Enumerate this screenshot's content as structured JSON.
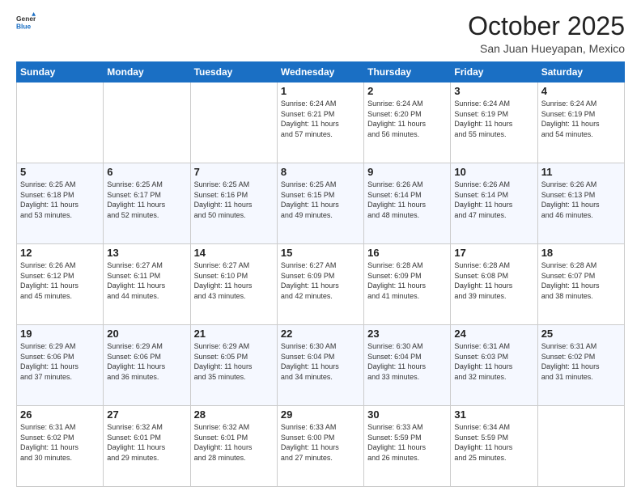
{
  "logo": {
    "general": "General",
    "blue": "Blue"
  },
  "title": "October 2025",
  "location": "San Juan Hueyapan, Mexico",
  "weekdays": [
    "Sunday",
    "Monday",
    "Tuesday",
    "Wednesday",
    "Thursday",
    "Friday",
    "Saturday"
  ],
  "weeks": [
    [
      {
        "day": "",
        "info": ""
      },
      {
        "day": "",
        "info": ""
      },
      {
        "day": "",
        "info": ""
      },
      {
        "day": "1",
        "info": "Sunrise: 6:24 AM\nSunset: 6:21 PM\nDaylight: 11 hours\nand 57 minutes."
      },
      {
        "day": "2",
        "info": "Sunrise: 6:24 AM\nSunset: 6:20 PM\nDaylight: 11 hours\nand 56 minutes."
      },
      {
        "day": "3",
        "info": "Sunrise: 6:24 AM\nSunset: 6:19 PM\nDaylight: 11 hours\nand 55 minutes."
      },
      {
        "day": "4",
        "info": "Sunrise: 6:24 AM\nSunset: 6:19 PM\nDaylight: 11 hours\nand 54 minutes."
      }
    ],
    [
      {
        "day": "5",
        "info": "Sunrise: 6:25 AM\nSunset: 6:18 PM\nDaylight: 11 hours\nand 53 minutes."
      },
      {
        "day": "6",
        "info": "Sunrise: 6:25 AM\nSunset: 6:17 PM\nDaylight: 11 hours\nand 52 minutes."
      },
      {
        "day": "7",
        "info": "Sunrise: 6:25 AM\nSunset: 6:16 PM\nDaylight: 11 hours\nand 50 minutes."
      },
      {
        "day": "8",
        "info": "Sunrise: 6:25 AM\nSunset: 6:15 PM\nDaylight: 11 hours\nand 49 minutes."
      },
      {
        "day": "9",
        "info": "Sunrise: 6:26 AM\nSunset: 6:14 PM\nDaylight: 11 hours\nand 48 minutes."
      },
      {
        "day": "10",
        "info": "Sunrise: 6:26 AM\nSunset: 6:14 PM\nDaylight: 11 hours\nand 47 minutes."
      },
      {
        "day": "11",
        "info": "Sunrise: 6:26 AM\nSunset: 6:13 PM\nDaylight: 11 hours\nand 46 minutes."
      }
    ],
    [
      {
        "day": "12",
        "info": "Sunrise: 6:26 AM\nSunset: 6:12 PM\nDaylight: 11 hours\nand 45 minutes."
      },
      {
        "day": "13",
        "info": "Sunrise: 6:27 AM\nSunset: 6:11 PM\nDaylight: 11 hours\nand 44 minutes."
      },
      {
        "day": "14",
        "info": "Sunrise: 6:27 AM\nSunset: 6:10 PM\nDaylight: 11 hours\nand 43 minutes."
      },
      {
        "day": "15",
        "info": "Sunrise: 6:27 AM\nSunset: 6:09 PM\nDaylight: 11 hours\nand 42 minutes."
      },
      {
        "day": "16",
        "info": "Sunrise: 6:28 AM\nSunset: 6:09 PM\nDaylight: 11 hours\nand 41 minutes."
      },
      {
        "day": "17",
        "info": "Sunrise: 6:28 AM\nSunset: 6:08 PM\nDaylight: 11 hours\nand 39 minutes."
      },
      {
        "day": "18",
        "info": "Sunrise: 6:28 AM\nSunset: 6:07 PM\nDaylight: 11 hours\nand 38 minutes."
      }
    ],
    [
      {
        "day": "19",
        "info": "Sunrise: 6:29 AM\nSunset: 6:06 PM\nDaylight: 11 hours\nand 37 minutes."
      },
      {
        "day": "20",
        "info": "Sunrise: 6:29 AM\nSunset: 6:06 PM\nDaylight: 11 hours\nand 36 minutes."
      },
      {
        "day": "21",
        "info": "Sunrise: 6:29 AM\nSunset: 6:05 PM\nDaylight: 11 hours\nand 35 minutes."
      },
      {
        "day": "22",
        "info": "Sunrise: 6:30 AM\nSunset: 6:04 PM\nDaylight: 11 hours\nand 34 minutes."
      },
      {
        "day": "23",
        "info": "Sunrise: 6:30 AM\nSunset: 6:04 PM\nDaylight: 11 hours\nand 33 minutes."
      },
      {
        "day": "24",
        "info": "Sunrise: 6:31 AM\nSunset: 6:03 PM\nDaylight: 11 hours\nand 32 minutes."
      },
      {
        "day": "25",
        "info": "Sunrise: 6:31 AM\nSunset: 6:02 PM\nDaylight: 11 hours\nand 31 minutes."
      }
    ],
    [
      {
        "day": "26",
        "info": "Sunrise: 6:31 AM\nSunset: 6:02 PM\nDaylight: 11 hours\nand 30 minutes."
      },
      {
        "day": "27",
        "info": "Sunrise: 6:32 AM\nSunset: 6:01 PM\nDaylight: 11 hours\nand 29 minutes."
      },
      {
        "day": "28",
        "info": "Sunrise: 6:32 AM\nSunset: 6:01 PM\nDaylight: 11 hours\nand 28 minutes."
      },
      {
        "day": "29",
        "info": "Sunrise: 6:33 AM\nSunset: 6:00 PM\nDaylight: 11 hours\nand 27 minutes."
      },
      {
        "day": "30",
        "info": "Sunrise: 6:33 AM\nSunset: 5:59 PM\nDaylight: 11 hours\nand 26 minutes."
      },
      {
        "day": "31",
        "info": "Sunrise: 6:34 AM\nSunset: 5:59 PM\nDaylight: 11 hours\nand 25 minutes."
      },
      {
        "day": "",
        "info": ""
      }
    ]
  ]
}
